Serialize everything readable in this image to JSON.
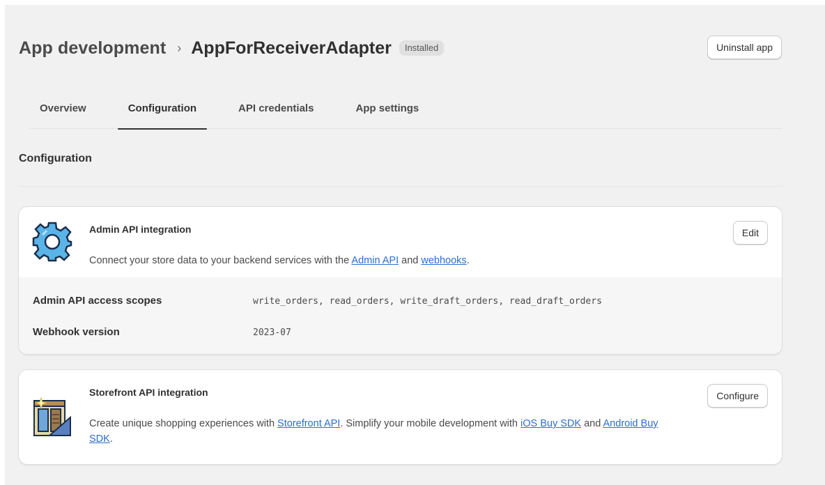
{
  "header": {
    "breadcrumb_root": "App development",
    "breadcrumb_separator": "›",
    "app_name": "AppForReceiverAdapter",
    "status_badge": "Installed",
    "uninstall_label": "Uninstall app"
  },
  "tabs": [
    {
      "label": "Overview"
    },
    {
      "label": "Configuration"
    },
    {
      "label": "API credentials"
    },
    {
      "label": "App settings"
    }
  ],
  "active_tab": "Configuration",
  "section": {
    "title": "Configuration"
  },
  "admin_card": {
    "title": "Admin API integration",
    "desc_prefix": "Connect your store data to your backend services with the ",
    "link_admin_api": "Admin API",
    "desc_and": " and ",
    "link_webhooks": "webhooks",
    "desc_suffix": ".",
    "edit_label": "Edit",
    "icon": "gear-icon",
    "scopes_label": "Admin API access scopes",
    "scopes_value": "write_orders, read_orders, write_draft_orders, read_draft_orders",
    "webhook_label": "Webhook version",
    "webhook_value": "2023-07"
  },
  "storefront_card": {
    "title": "Storefront API integration",
    "desc_prefix": "Create unique shopping experiences with ",
    "link_storefront_api": "Storefront API",
    "desc_mid": ". Simplify your mobile development with ",
    "link_ios_sdk": "iOS Buy SDK",
    "desc_and": " and ",
    "link_android_sdk": "Android Buy SDK",
    "desc_suffix": ".",
    "configure_label": "Configure",
    "icon": "storefront-building-icon"
  },
  "colors": {
    "link": "#2c6ecb",
    "page_bg": "#f1f1f1",
    "card_bg": "#ffffff",
    "gear_fill": "#5ab4e8"
  }
}
